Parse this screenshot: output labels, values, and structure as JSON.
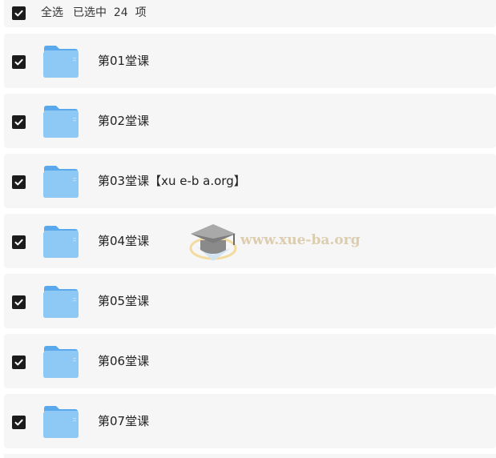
{
  "header": {
    "select_all_label": "全选",
    "selected_count_text": "已选中  24  项",
    "select_all_checked": true
  },
  "folders": [
    {
      "name": "第01堂课",
      "checked": true
    },
    {
      "name": "第02堂课",
      "checked": true
    },
    {
      "name": "第03堂课【xu e-b a.org】",
      "checked": true
    },
    {
      "name": "第04堂课",
      "checked": true
    },
    {
      "name": "第05堂课",
      "checked": true
    },
    {
      "name": "第06堂课",
      "checked": true
    },
    {
      "name": "第07堂课",
      "checked": true
    }
  ],
  "watermark": {
    "text": "www.xue-ba.org",
    "icon": "graduation-cap-icon"
  },
  "colors": {
    "row_background": "#f6f6f6",
    "checkbox_fill": "#1c1c1c",
    "folder_blue": "#8ec9f5",
    "text_dark": "#222222"
  }
}
